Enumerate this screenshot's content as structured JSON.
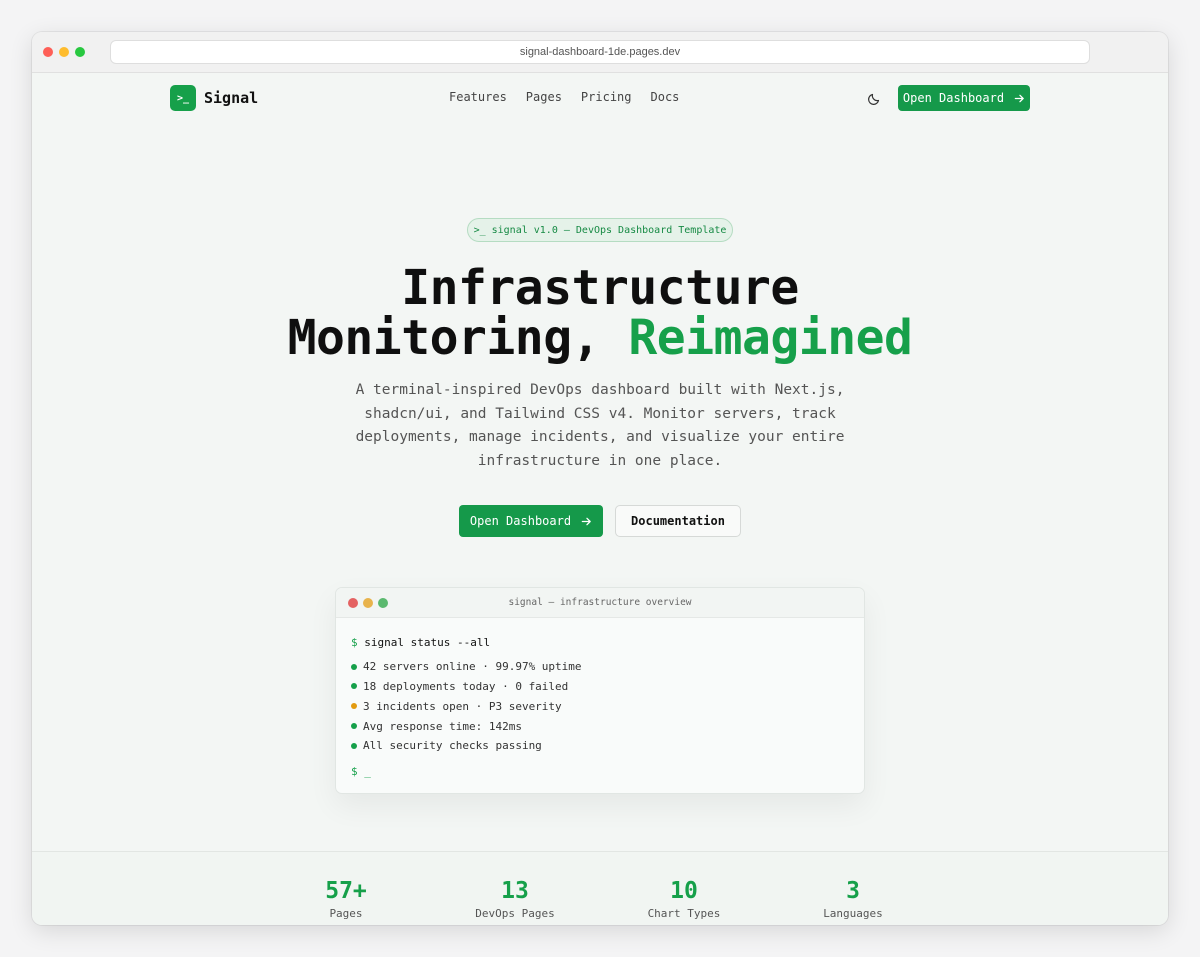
{
  "browser": {
    "url": "signal-dashboard-1de.pages.dev"
  },
  "nav": {
    "logo_icon": ">_",
    "logo_text": "Signal",
    "links": [
      "Features",
      "Pages",
      "Pricing",
      "Docs"
    ],
    "cta_label": "Open Dashboard"
  },
  "hero": {
    "badge": ">_ signal v1.0 — DevOps Dashboard Template",
    "headline_line1": "Infrastructure",
    "headline_line2": "Monitoring,",
    "headline_accent": "Reimagined",
    "subtext": "A terminal-inspired DevOps dashboard built with Next.js, shadcn/ui, and Tailwind CSS v4. Monitor servers, track deployments, manage incidents, and visualize your entire infrastructure in one place.",
    "primary_cta": "Open Dashboard",
    "secondary_cta": "Documentation"
  },
  "terminal": {
    "title": "signal — infrastructure overview",
    "prompt": "$",
    "command": "signal status --all",
    "lines": [
      {
        "text": "42 servers online  ·  99.97% uptime",
        "status": "ok"
      },
      {
        "text": "18 deployments today  ·  0 failed",
        "status": "ok"
      },
      {
        "text": "3 incidents open  ·  P3 severity",
        "status": "warn"
      },
      {
        "text": "Avg response time: 142ms",
        "status": "ok"
      },
      {
        "text": "All security checks passing",
        "status": "ok"
      }
    ],
    "cursor": "_"
  },
  "stats": [
    {
      "value": "57+",
      "label": "Pages"
    },
    {
      "value": "13",
      "label": "DevOps Pages"
    },
    {
      "value": "10",
      "label": "Chart Types"
    },
    {
      "value": "3",
      "label": "Languages"
    }
  ],
  "colors": {
    "accent": "#16a04a",
    "warning": "#e39b10"
  }
}
